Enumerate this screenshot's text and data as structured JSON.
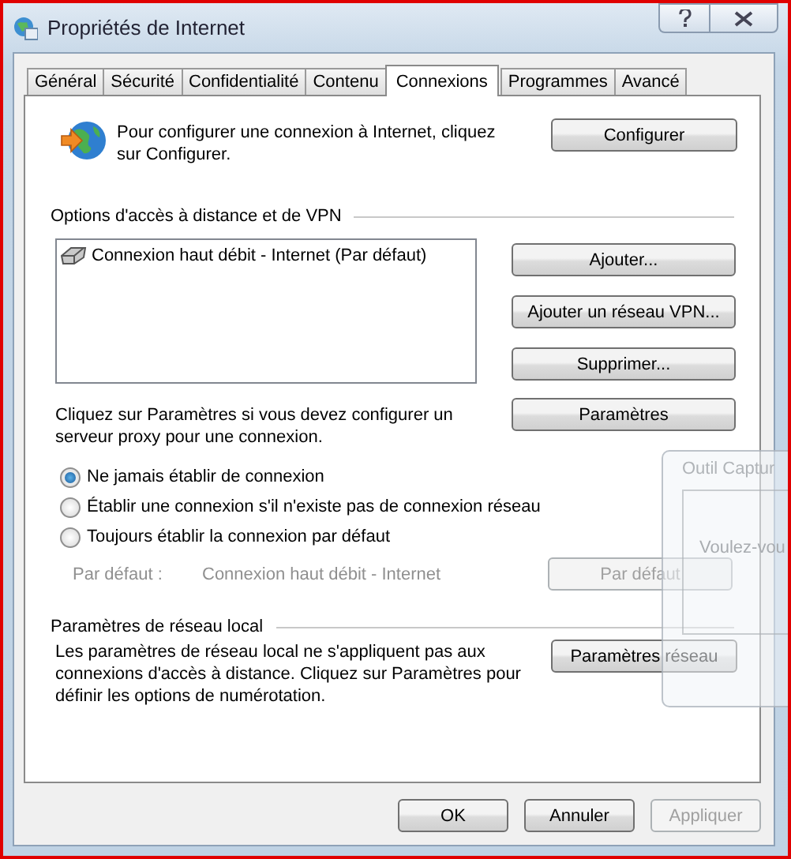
{
  "window": {
    "title": "Propriétés de Internet"
  },
  "tabs": [
    {
      "label": "Général",
      "selected": false
    },
    {
      "label": "Sécurité",
      "selected": false
    },
    {
      "label": "Confidentialité",
      "selected": false
    },
    {
      "label": "Contenu",
      "selected": false
    },
    {
      "label": "Connexions",
      "selected": true
    },
    {
      "label": "Programmes",
      "selected": false
    },
    {
      "label": "Avancé",
      "selected": false
    }
  ],
  "setup": {
    "text": "Pour configurer une connexion à Internet, cliquez sur Configurer.",
    "button": "Configurer"
  },
  "dialup": {
    "heading": "Options d'accès à distance et de VPN",
    "connections": [
      {
        "label": "Connexion haut débit - Internet (Par défaut)",
        "selected": false
      }
    ],
    "buttons": [
      "Ajouter...",
      "Ajouter un réseau VPN...",
      "Supprimer..."
    ],
    "proxy_text": "Cliquez sur Paramètres si vous devez configurer un serveur proxy pour une connexion.",
    "settings_button": "Paramètres"
  },
  "radios": [
    {
      "label": "Ne jamais établir de connexion",
      "selected": true
    },
    {
      "label": "Établir une connexion s'il n'existe pas de connexion réseau",
      "selected": false
    },
    {
      "label": "Toujours établir la connexion par défaut",
      "selected": false
    }
  ],
  "default_row": {
    "label": "Par défaut :",
    "value": "Connexion haut débit - Internet",
    "button": "Par défaut",
    "disabled": true
  },
  "lan": {
    "heading": "Paramètres de réseau local",
    "text": "Les paramètres de réseau local ne s'appliquent pas aux connexions d'accès à distance. Cliquez sur Paramètres pour définir les options de numérotation.",
    "button": "Paramètres réseau"
  },
  "buttons": [
    {
      "label": "OK",
      "disabled": false
    },
    {
      "label": "Annuler",
      "disabled": false
    },
    {
      "label": "Appliquer",
      "disabled": true
    }
  ],
  "overlay": {
    "title": "Outil Captur",
    "text": "Voulez-vou"
  }
}
